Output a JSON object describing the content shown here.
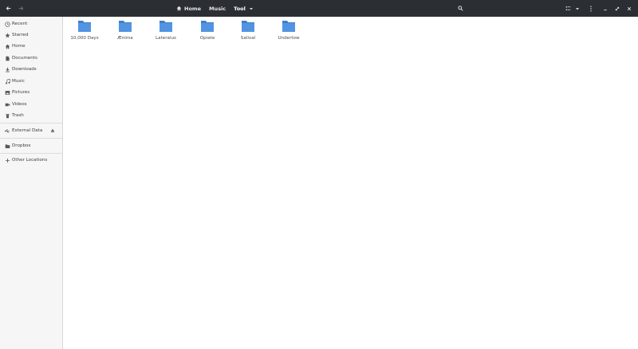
{
  "header": {
    "breadcrumbs": [
      {
        "label": "Home"
      },
      {
        "label": "Music"
      },
      {
        "label": "Tool"
      }
    ]
  },
  "sidebar": {
    "items": [
      {
        "label": "Recent",
        "icon": "clock-icon"
      },
      {
        "label": "Starred",
        "icon": "star-icon"
      },
      {
        "label": "Home",
        "icon": "home-icon"
      },
      {
        "label": "Documents",
        "icon": "document-icon"
      },
      {
        "label": "Downloads",
        "icon": "download-icon"
      },
      {
        "label": "Music",
        "icon": "music-icon"
      },
      {
        "label": "Pictures",
        "icon": "picture-icon"
      },
      {
        "label": "Videos",
        "icon": "video-icon"
      },
      {
        "label": "Trash",
        "icon": "trash-icon"
      }
    ],
    "devices": [
      {
        "label": "External Data",
        "icon": "usb-icon"
      }
    ],
    "bookmarks": [
      {
        "label": "Dropbox",
        "icon": "folder-icon"
      }
    ],
    "other": {
      "label": "Other Locations",
      "icon": "plus-icon"
    }
  },
  "folders": [
    {
      "name": "10,000 Days"
    },
    {
      "name": "Ænima"
    },
    {
      "name": "Lateralus"
    },
    {
      "name": "Opiate"
    },
    {
      "name": "Salival"
    },
    {
      "name": "Undertow"
    }
  ],
  "colors": {
    "headerbar": "#2b2e33",
    "folder": "#5294e2",
    "folder_dark": "#3f7ec9",
    "sidebar": "#f6f6f6"
  }
}
